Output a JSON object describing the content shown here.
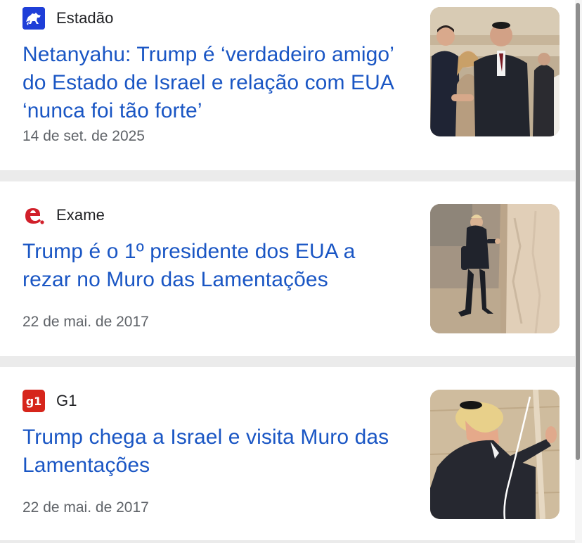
{
  "articles": [
    {
      "source": "Estadão",
      "source_icon": "estadao-horse-logo-icon",
      "headline": "Netanyahu: Trump é ‘verdadeiro amigo’ do Estado de Israel e relação com EUA ‘nunca foi tão forte’",
      "date": "14 de set. de 2025"
    },
    {
      "source": "Exame",
      "source_icon": "exame-e-logo-icon",
      "headline": "Trump é o 1º presidente dos EUA a rezar no Muro das Lamentações",
      "date": "22 de mai. de 2017"
    },
    {
      "source": "G1",
      "source_icon": "g1-logo-icon",
      "logo_text": "g1",
      "headline": "Trump chega a Israel e visita Muro das Lamentações",
      "date": "22 de mai. de 2017"
    }
  ],
  "colors": {
    "headline": "#1a56c4",
    "estadao_brand": "#1f3fd8",
    "exame_brand": "#d11f2a",
    "g1_brand": "#d6251b",
    "separator": "#ebebeb"
  }
}
